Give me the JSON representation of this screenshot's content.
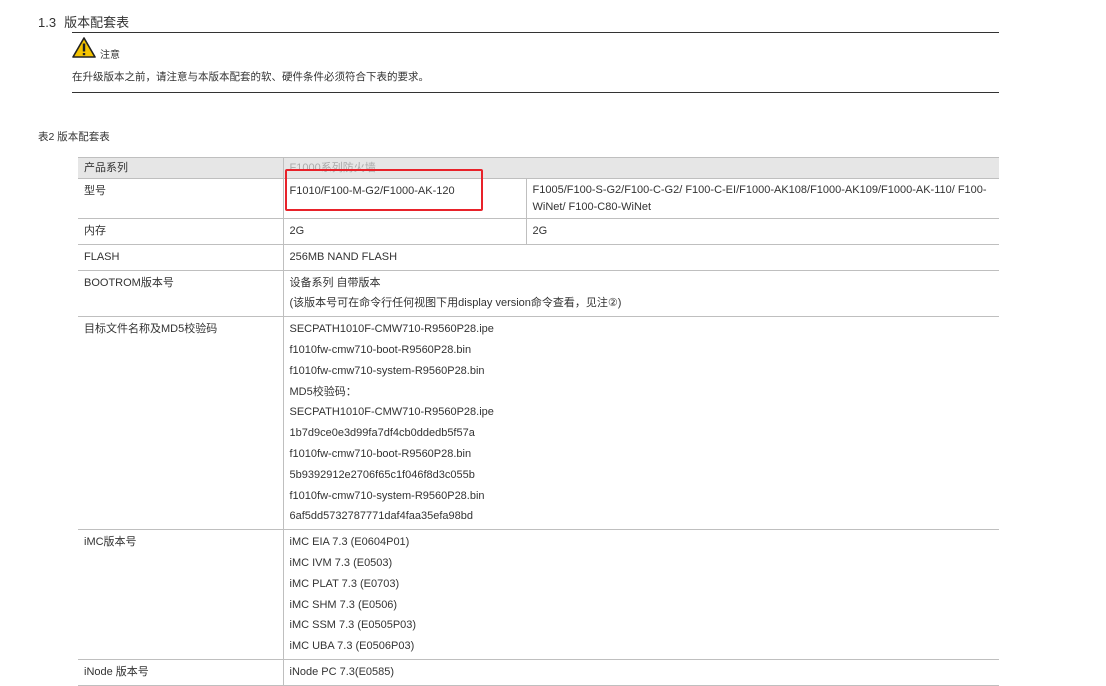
{
  "section": {
    "number": "1.3",
    "title": "版本配套表"
  },
  "note": {
    "label": "注意",
    "text": "在升级版本之前，请注意与本版本配套的软、硬件条件必须符合下表的要求。"
  },
  "table_caption": "表2 版本配套表",
  "table": {
    "header": {
      "label": "产品系列",
      "value": "F1000系列防火墙"
    },
    "model": {
      "label": "型号",
      "col1": "F1010/F100-M-G2/F1000-AK-120",
      "col2": "F1005/F100-S-G2/F100-C-G2/ F100-C-EI/F1000-AK108/F1000-AK109/F1000-AK-110/ F100-WiNet/ F100-C80-WiNet"
    },
    "memory": {
      "label": "内存",
      "col1": "2G",
      "col2": "2G"
    },
    "flash": {
      "label": "FLASH",
      "value": "256MB  NAND FLASH"
    },
    "bootrom": {
      "label": "BOOTROM版本号",
      "lines": [
        "设备系列 自带版本",
        "(该版本号可在命令行任何视图下用display version命令查看，见注②)"
      ]
    },
    "files": {
      "label": "目标文件名称及MD5校验码",
      "lines": [
        "SECPATH1010F-CMW710-R9560P28.ipe",
        "f1010fw-cmw710-boot-R9560P28.bin",
        "f1010fw-cmw710-system-R9560P28.bin",
        "MD5校验码：",
        "SECPATH1010F-CMW710-R9560P28.ipe",
        "1b7d9ce0e3d99fa7df4cb0ddedb5f57a",
        "f1010fw-cmw710-boot-R9560P28.bin",
        "5b9392912e2706f65c1f046f8d3c055b",
        "f1010fw-cmw710-system-R9560P28.bin",
        "6af5dd5732787771daf4faa35efa98bd"
      ]
    },
    "imc": {
      "label": "iMC版本号",
      "lines": [
        "iMC EIA 7.3 (E0604P01)",
        "iMC IVM 7.3 (E0503)",
        "iMC PLAT 7.3 (E0703)",
        "iMC SHM 7.3 (E0506)",
        "iMC SSM 7.3 (E0505P03)",
        "iMC UBA 7.3 (E0506P03)"
      ]
    },
    "inode": {
      "label": "iNode 版本号",
      "value": "iNode PC 7.3(E0585)"
    }
  },
  "colors": {
    "highlight": "#e8222a",
    "header_bg": "#e6e6e6",
    "border": "#bfbfbf",
    "warning": "#f5c400"
  },
  "icons": {
    "note": "warning-triangle-icon"
  }
}
